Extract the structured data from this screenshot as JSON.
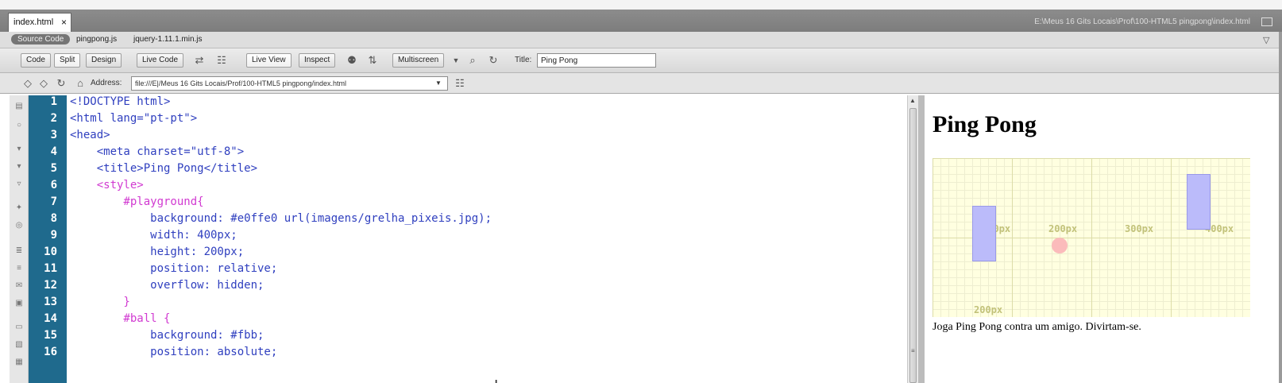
{
  "document_tab": {
    "filename": "index.html",
    "close_glyph": "×"
  },
  "path_display": "E:\\Meus 16 Gits Locais\\Prof\\100-HTML5 pingpong\\index.html",
  "related_files": {
    "source_code": "Source Code",
    "files": [
      "pingpong.js",
      "jquery-1.11.1.min.js"
    ]
  },
  "toolbar": {
    "code": "Code",
    "split": "Split",
    "design": "Design",
    "live_code": "Live Code",
    "live_view": "Live View",
    "inspect": "Inspect",
    "multiscreen": "Multiscreen",
    "title_label": "Title:",
    "title_value": "Ping Pong"
  },
  "address_bar": {
    "label": "Address:",
    "value": "file:///E|/Meus 16 Gits Locais/Prof/100-HTML5 pingpong/index.html"
  },
  "code": {
    "line_numbers": [
      "1",
      "2",
      "3",
      "4",
      "5",
      "6",
      "7",
      "8",
      "9",
      "10",
      "11",
      "12",
      "13",
      "14",
      "15",
      "16"
    ],
    "lines": [
      "<!DOCTYPE html>",
      "<html lang=\"pt-pt\">",
      "<head>",
      "    <meta charset=\"utf-8\">",
      "    <title>Ping Pong</title>",
      "    <style>",
      "        #playground{",
      "            background: #e0ffe0 url(imagens/grelha_pixeis.jpg);",
      "            width: 400px;",
      "            height: 200px;",
      "            position: relative;",
      "            overflow: hidden;",
      "        }",
      "        #ball {",
      "            background: #fbb;",
      "            position: absolute;"
    ]
  },
  "live_view": {
    "heading": "Ping Pong",
    "grid_labels": [
      "100px",
      "200px",
      "300px",
      "400px",
      "200px"
    ],
    "text": "Joga Ping Pong contra um amigo. Divirtam-se."
  },
  "colors": {
    "line_number_bg": "#1f6a8d",
    "tag_color": "#2f3fbf",
    "selector_color": "#d13ad1",
    "playground_bg": "#ffffe0",
    "paddle_color": "#bbbbfa",
    "ball_color": "#fbbbbb"
  }
}
